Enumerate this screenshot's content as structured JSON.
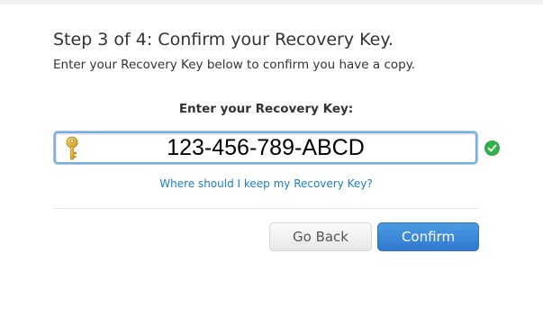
{
  "dialog": {
    "title": "Step 3 of 4: Confirm your Recovery Key.",
    "subtitle": "Enter your Recovery Key below to confirm you have a copy."
  },
  "recovery_key": {
    "label": "Enter your Recovery Key:",
    "value": "123-456-789-ABCD",
    "field_icon": "key-icon",
    "valid_icon": "checkmark-circle-icon"
  },
  "help_link": {
    "text": "Where should I keep my Recovery Key?"
  },
  "buttons": {
    "back_label": "Go Back",
    "confirm_label": "Confirm"
  },
  "colors": {
    "accent": "#2f79d0",
    "link": "#1d7ec9",
    "valid": "#2fb34a",
    "focus_ring": "#79aede"
  }
}
